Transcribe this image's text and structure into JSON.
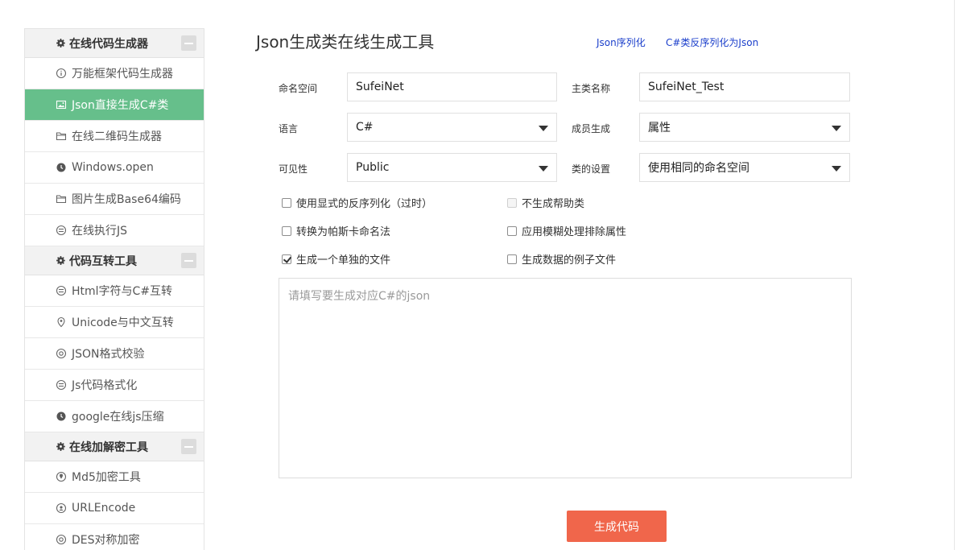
{
  "sidebar": {
    "sections": [
      {
        "title": "在线代码生成器",
        "items": [
          {
            "label": "万能框架代码生成器",
            "icon": "info-circle-icon"
          },
          {
            "label": "Json直接生成C#类",
            "icon": "image-icon",
            "active": true
          },
          {
            "label": "在线二维码生成器",
            "icon": "folder-icon"
          },
          {
            "label": "Windows.open",
            "icon": "clock-icon"
          },
          {
            "label": "图片生成Base64编码",
            "icon": "folder-icon"
          },
          {
            "label": "在线执行JS",
            "icon": "circle-lines-icon"
          }
        ]
      },
      {
        "title": "代码互转工具",
        "items": [
          {
            "label": "Html字符与C#互转",
            "icon": "circle-lines-icon"
          },
          {
            "label": "Unicode与中文互转",
            "icon": "location-pin-icon"
          },
          {
            "label": "JSON格式校验",
            "icon": "circle-letter-icon"
          },
          {
            "label": "Js代码格式化",
            "icon": "circle-lines-icon"
          },
          {
            "label": "google在线js压缩",
            "icon": "clock-icon"
          }
        ]
      },
      {
        "title": "在线加解密工具",
        "items": [
          {
            "label": "Md5加密工具",
            "icon": "location-pin-icon"
          },
          {
            "label": "URLEncode",
            "icon": "circle-letter-icon"
          },
          {
            "label": "DES对称加密",
            "icon": "circle-letter-icon"
          }
        ]
      }
    ]
  },
  "header": {
    "title": "Json生成类在线生成工具",
    "link1": "Json序列化",
    "link2": "C#类反序列化为Json"
  },
  "form": {
    "namespace_label": "命名空间",
    "namespace_value": "SufeiNet",
    "mainclass_label": "主类名称",
    "mainclass_value": "SufeiNet_Test",
    "language_label": "语言",
    "language_value": "C#",
    "member_label": "成员生成",
    "member_value": "属性",
    "visibility_label": "可见性",
    "visibility_value": "Public",
    "classsetting_label": "类的设置",
    "classsetting_value": "使用相同的命名空间"
  },
  "options": {
    "explicit_deserialize": {
      "label": "使用显式的反序列化（过时）",
      "checked": false
    },
    "no_helper": {
      "label": "不生成帮助类",
      "checked": false,
      "disabled": true
    },
    "pascal_case": {
      "label": "转换为帕斯卡命名法",
      "checked": false
    },
    "fuzzy_exclude": {
      "label": "应用模糊处理排除属性",
      "checked": false
    },
    "single_file": {
      "label": "生成一个单独的文件",
      "checked": true
    },
    "sample_file": {
      "label": "生成数据的例子文件",
      "checked": false
    }
  },
  "json_input": {
    "placeholder": "请填写要生成对应C#的json",
    "value": ""
  },
  "generate_button": "生成代码",
  "colors": {
    "accent_green": "#66bf8b",
    "button_orange": "#f0664b",
    "link_blue": "#1a3ecb"
  }
}
